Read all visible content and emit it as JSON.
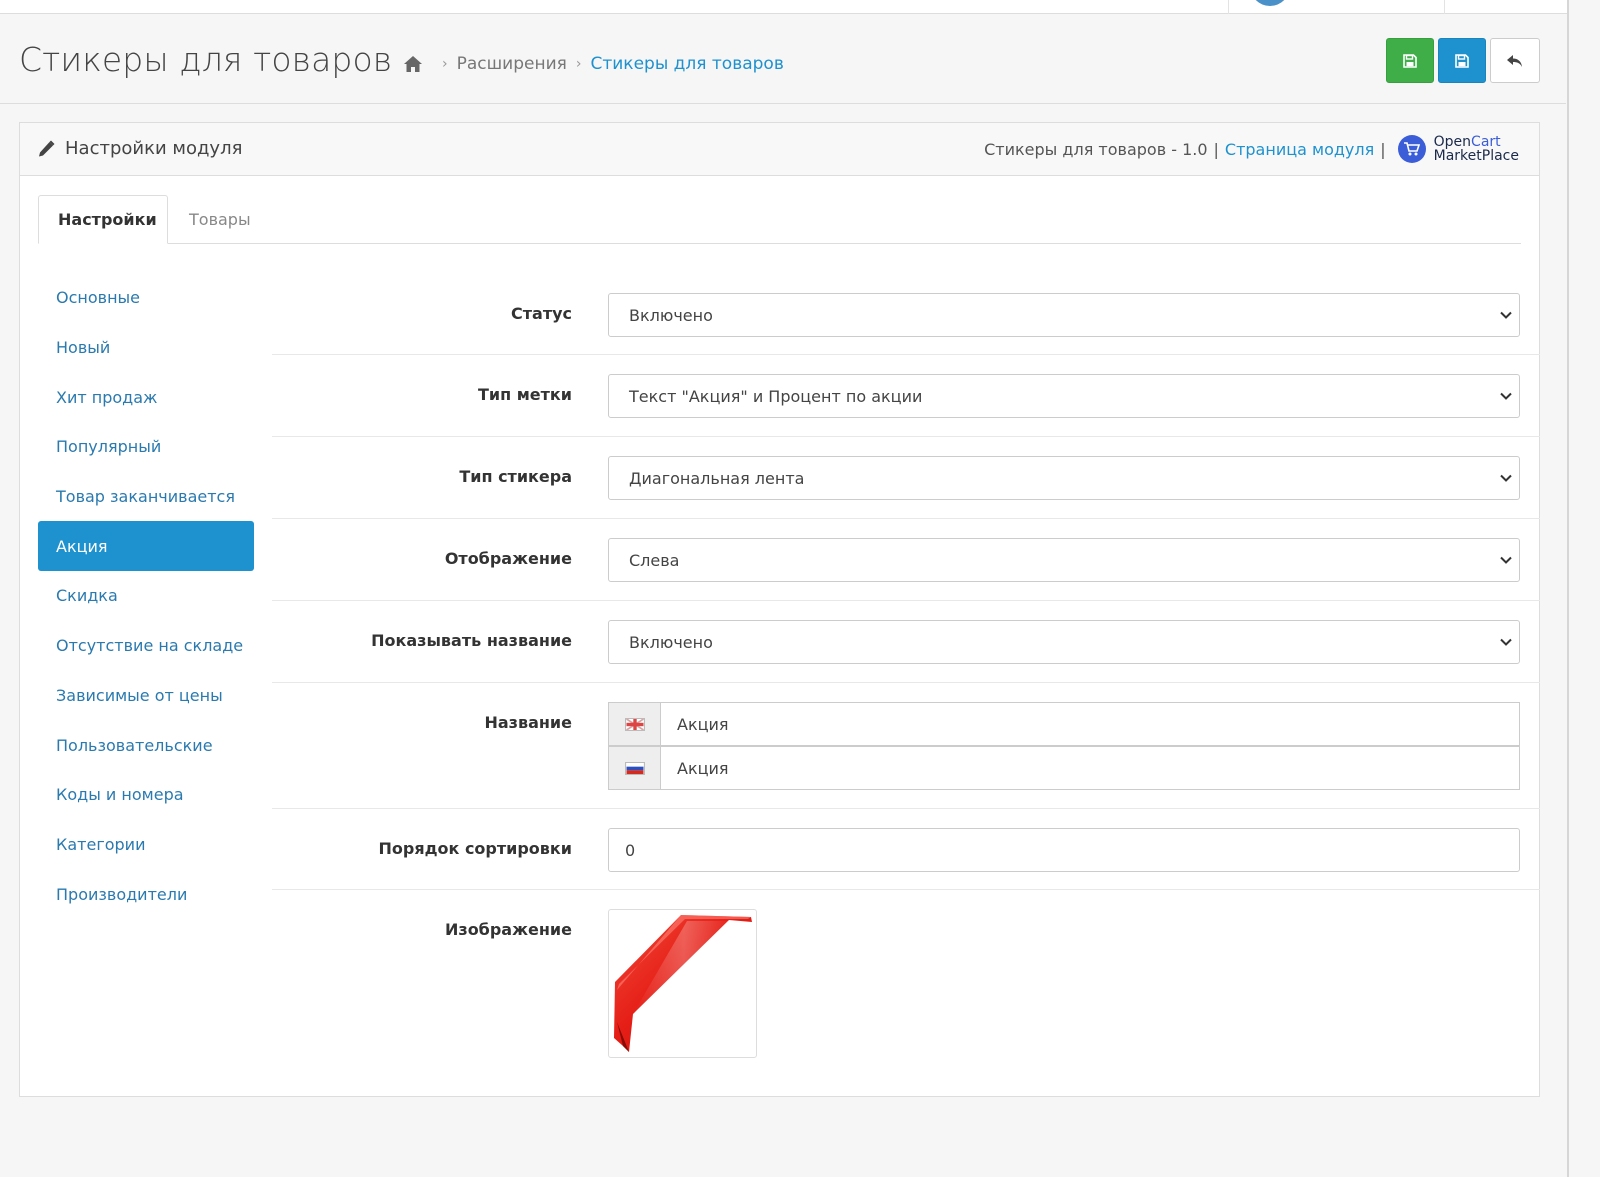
{
  "header": {
    "title": "Стикеры для товаров",
    "breadcrumb": [
      {
        "label": "Расширения"
      },
      {
        "label": "Стикеры для товаров"
      }
    ]
  },
  "panel": {
    "title": "Настройки модуля",
    "meta_version": "Стикеры для товаров - 1.0",
    "meta_link": "Страница модуля",
    "logo_line1_a": "Open",
    "logo_line1_b": "Cart",
    "logo_line2": "MarketPlace"
  },
  "tabs": [
    {
      "label": "Настройки",
      "active": true
    },
    {
      "label": "Товары",
      "active": false
    }
  ],
  "sidebar": {
    "items": [
      {
        "label": "Основные"
      },
      {
        "label": "Новый"
      },
      {
        "label": "Хит продаж"
      },
      {
        "label": "Популярный"
      },
      {
        "label": "Товар заканчивается"
      },
      {
        "label": "Акция",
        "active": true
      },
      {
        "label": "Скидка"
      },
      {
        "label": "Отсутствие на складе"
      },
      {
        "label": "Зависимые от цены"
      },
      {
        "label": "Пользовательские"
      },
      {
        "label": "Коды и номера"
      },
      {
        "label": "Категории"
      },
      {
        "label": "Производители"
      }
    ]
  },
  "form": {
    "status": {
      "label": "Статус",
      "value": "Включено"
    },
    "label_type": {
      "label": "Тип метки",
      "value": "Текст \"Акция\" и Процент по акции"
    },
    "sticker_type": {
      "label": "Тип стикера",
      "value": "Диагональная лента"
    },
    "display": {
      "label": "Отображение",
      "value": "Слева"
    },
    "show_name": {
      "label": "Показывать название",
      "value": "Включено"
    },
    "name": {
      "label": "Название",
      "values": [
        {
          "lang": "en",
          "value": "Акция"
        },
        {
          "lang": "ru",
          "value": "Акция"
        }
      ]
    },
    "sort_order": {
      "label": "Порядок сортировки",
      "value": "0"
    },
    "image": {
      "label": "Изображение"
    }
  },
  "colors": {
    "primary": "#1e91cf",
    "success": "#3fae49",
    "ribbon": "#e0221c"
  }
}
